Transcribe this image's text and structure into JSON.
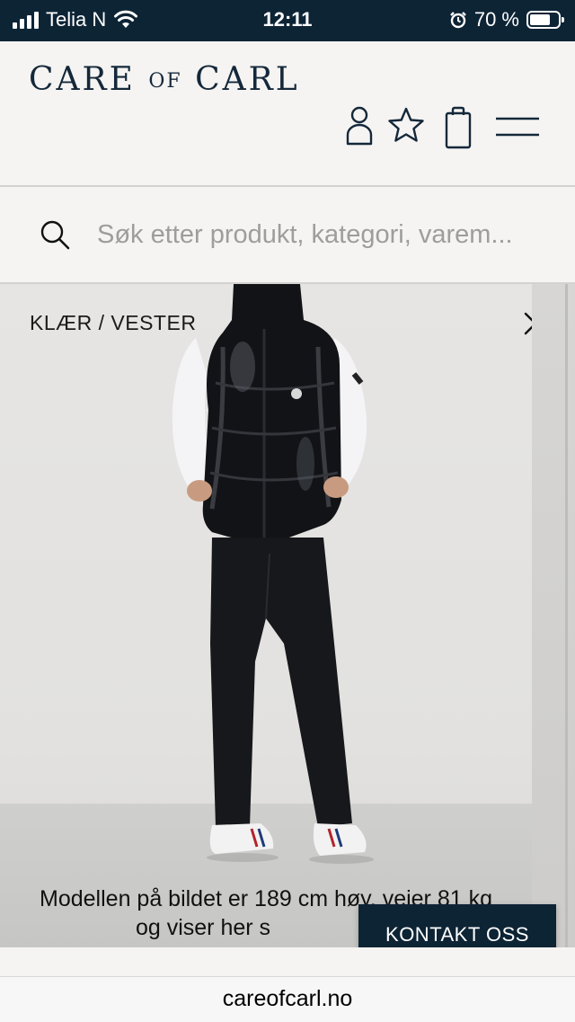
{
  "status_bar": {
    "carrier": "Telia N",
    "time": "12:11",
    "battery": "70 %"
  },
  "header": {
    "logo_part1": "CARE ",
    "logo_part2": "OF",
    "logo_part3": " CARL",
    "icons": [
      "user-icon",
      "star-icon",
      "bag-icon",
      "menu-icon"
    ]
  },
  "search": {
    "placeholder": "Søk etter produkt, kategori, varem..."
  },
  "product": {
    "breadcrumb": "KLÆR / VESTER",
    "model_note_line1": "Modellen på bildet er 189 cm høy, veier 81 kg",
    "model_note_line2": "og viser her s"
  },
  "contact_button": {
    "label": "KONTAKT OSS"
  },
  "browser": {
    "url": "careofcarl.no"
  },
  "colors": {
    "navy": "#0d2435",
    "background": "#f5f4f2"
  }
}
